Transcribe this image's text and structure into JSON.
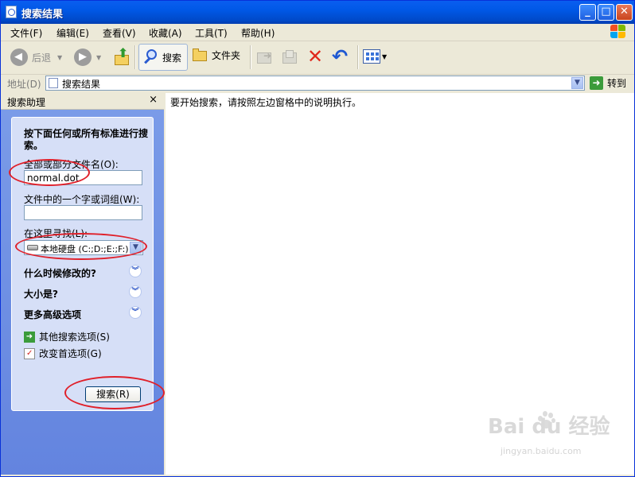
{
  "window": {
    "title": "搜索结果",
    "minimize": "_",
    "maximize": "□",
    "close": "✕"
  },
  "menu": [
    {
      "label": "文件(F)"
    },
    {
      "label": "编辑(E)"
    },
    {
      "label": "查看(V)"
    },
    {
      "label": "收藏(A)"
    },
    {
      "label": "工具(T)"
    },
    {
      "label": "帮助(H)"
    }
  ],
  "toolbar": {
    "back": "后退",
    "search": "搜索",
    "folders": "文件夹"
  },
  "address": {
    "label": "地址(D)",
    "value": "搜索结果",
    "go": "转到"
  },
  "panel": {
    "title": "搜索助理",
    "close": "×",
    "heading": "按下面任何或所有标准进行搜索。",
    "filename_label": "全部或部分文件名(O):",
    "filename_value": "normal.dot",
    "phrase_label": "文件中的一个字或词组(W):",
    "phrase_value": "",
    "lookin_label": "在这里寻找(L):",
    "lookin_value": "本地硬盘 (C:;D:;E:;F:)",
    "when_modified": "什么时候修改的?",
    "size": "大小是?",
    "advanced": "更多高级选项",
    "other_options": "其他搜索选项(S)",
    "change_prefs": "改变首选项(G)",
    "search_button": "搜索(R)"
  },
  "results": {
    "message": "要开始搜索，请按照左边窗格中的说明执行。"
  },
  "watermark": {
    "brand": "Bai  du 经验",
    "sub": "jingyan.baidu.com"
  },
  "colors": {
    "titlebar": "#0058e6",
    "panel_bg": "#6e8ce8",
    "card_bg": "#d6dff7",
    "annotation": "#e0202a"
  }
}
